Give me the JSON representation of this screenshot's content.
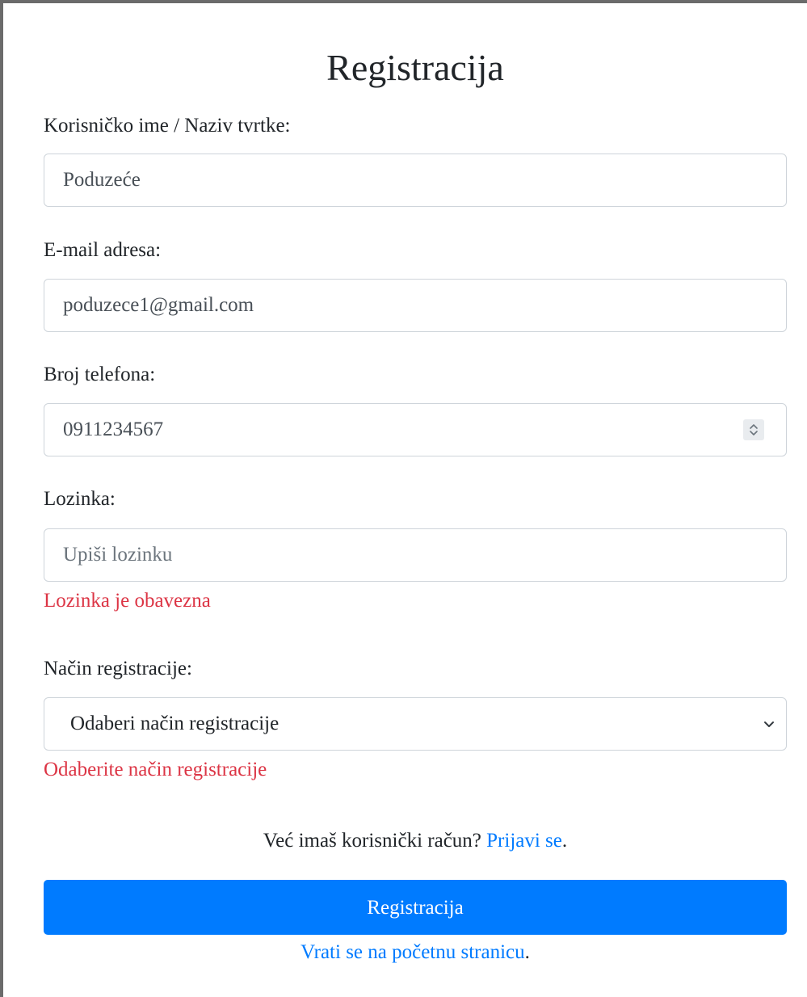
{
  "title": "Registracija",
  "fields": {
    "username": {
      "label": "Korisničko ime / Naziv tvrtke:",
      "value": "Poduzeće"
    },
    "email": {
      "label": "E-mail adresa:",
      "value": "poduzece1@gmail.com"
    },
    "phone": {
      "label": "Broj telefona:",
      "value": "0911234567"
    },
    "password": {
      "label": "Lozinka:",
      "value": "",
      "placeholder": "Upiši lozinku",
      "error": "Lozinka je obavezna"
    },
    "registration_method": {
      "label": "Način registracije:",
      "selected": "Odaberi način registracije",
      "error": "Odaberite način registracije"
    }
  },
  "login_prompt": {
    "text": "Već imaš korisnički račun?",
    "link": "Prijavi se",
    "suffix": "."
  },
  "submit_label": "Registracija",
  "home_link": {
    "link": "Vrati se na početnu stranicu",
    "suffix": "."
  },
  "colors": {
    "primary": "#007bff",
    "error": "#dc3545",
    "border": "#ced4da",
    "frame": "#6b6b6b"
  },
  "icons": {
    "spinner": "number-spinner-icon",
    "select": "chevron-down-icon"
  }
}
